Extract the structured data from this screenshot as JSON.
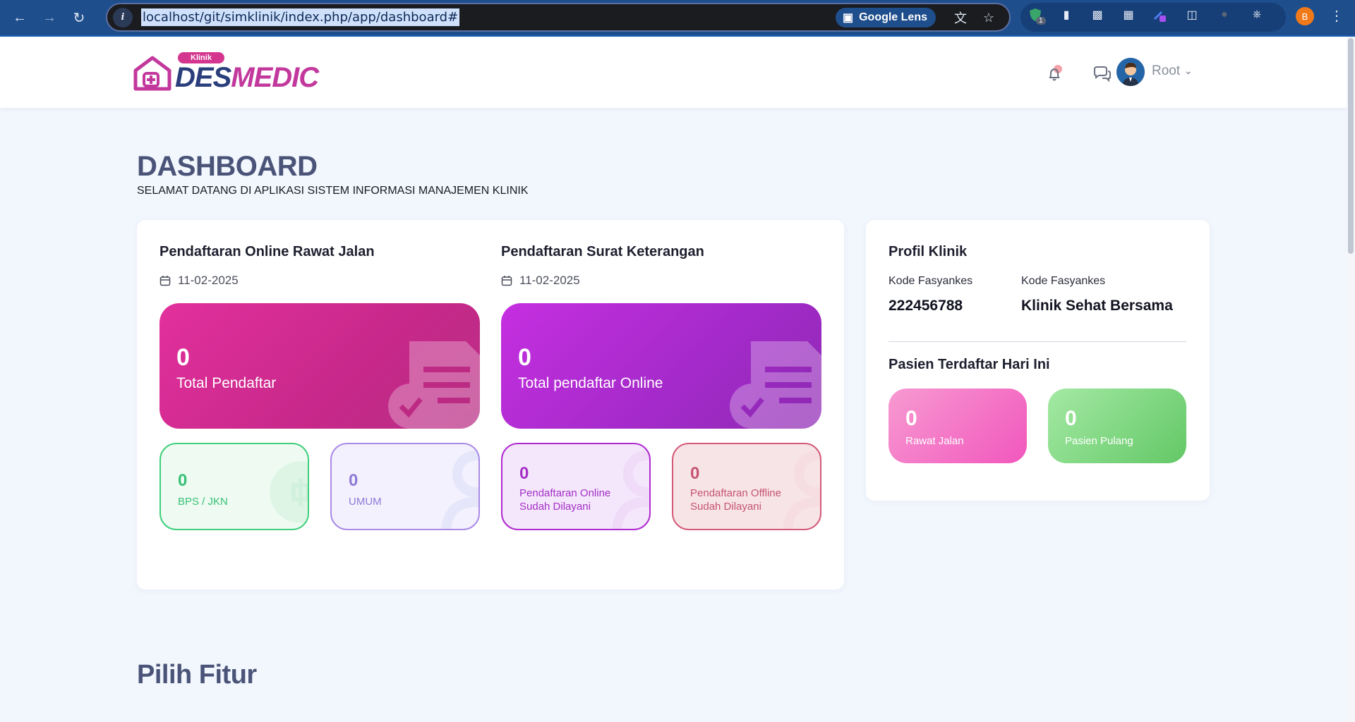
{
  "browser": {
    "url": "localhost/git/simklinik/index.php/app/dashboard#",
    "lens_label": "Google Lens",
    "profile_initial": "B",
    "extension_badge": "1"
  },
  "header": {
    "logo_badge": "Klinik",
    "logo_des": "DES",
    "logo_medic": "MEDIC",
    "user_name": "Root"
  },
  "page": {
    "title": "DASHBOARD",
    "subtitle": "SELAMAT DATANG DI APLIKASI SISTEM INFORMASI MANAJEMEN KLINIK"
  },
  "rawat_jalan": {
    "title": "Pendaftaran Online Rawat Jalan",
    "date": "11-02-2025",
    "total_value": "0",
    "total_label": "Total Pendaftar",
    "bpjs_value": "0",
    "bpjs_label": "BPS / JKN",
    "umum_value": "0",
    "umum_label": "UMUM"
  },
  "surat": {
    "title": "Pendaftaran Surat Keterangan",
    "date": "11-02-2025",
    "total_value": "0",
    "total_label": "Total pendaftar Online",
    "online_value": "0",
    "online_label_1": "Pendaftaran Online",
    "online_label_2": "Sudah Dilayani",
    "offline_value": "0",
    "offline_label_1": "Pendaftaran Offline",
    "offline_label_2": "Sudah Dilayani"
  },
  "profil": {
    "title": "Profil Klinik",
    "kode_label": "Kode Fasyankes",
    "kode_value": "222456788",
    "nama_label": "Kode Fasyankes",
    "nama_value": "Klinik Sehat Bersama",
    "pasien_title": "Pasien Terdaftar Hari Ini",
    "rawat_jalan_value": "0",
    "rawat_jalan_label": "Rawat Jalan",
    "pulang_value": "0",
    "pulang_label": "Pasien Pulang"
  },
  "features": {
    "title": "Pilih Fitur"
  },
  "colors": {
    "pink": "#e2309c",
    "purple": "#c52fe0",
    "green": "#3fcf7d",
    "accent_blue": "#1f4e8c"
  }
}
